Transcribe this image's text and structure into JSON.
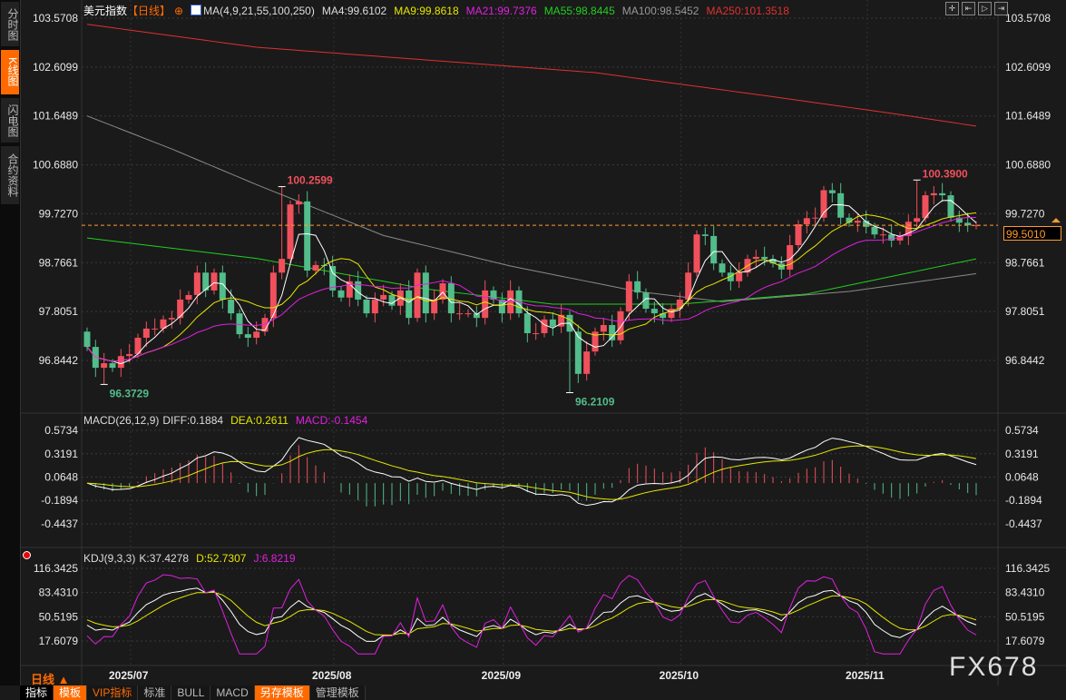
{
  "sidebar": {
    "tabs": [
      {
        "label": "分时图",
        "active": false
      },
      {
        "label": "K线图",
        "active": true
      },
      {
        "label": "闪电图",
        "active": false
      },
      {
        "label": "合约资料",
        "active": false
      }
    ]
  },
  "header": {
    "symbol": "美元指数",
    "period": "【日线】",
    "ma_label": "MA(4,9,21,55,100,250)",
    "ma4": "MA4:99.6102",
    "ma9": "MA9:99.8618",
    "ma21": "MA21:99.7376",
    "ma55": "MA55:98.8445",
    "ma100": "MA100:98.5452",
    "ma250": "MA250:101.3518"
  },
  "macd_header": {
    "label": "MACD(26,12,9)",
    "diff": "DIFF:0.1884",
    "dea": "DEA:0.2611",
    "macd": "MACD:-0.1454"
  },
  "kdj_header": {
    "label": "KDJ(9,3,3)",
    "k": "K:37.4278",
    "d": "D:52.7307",
    "j": "J:6.8219"
  },
  "tools": [
    "crosshair-icon",
    "zoom-start-icon",
    "play-icon",
    "jump-end-icon"
  ],
  "last_price": "99.5010",
  "period_selector": "日线 ▲",
  "watermark": "FX678",
  "toolbar": [
    {
      "label": "指标",
      "style": "white"
    },
    {
      "label": "模板",
      "style": "orange"
    },
    {
      "label": "VIP指标",
      "style": "vip"
    },
    {
      "label": "标准",
      "style": ""
    },
    {
      "label": "BULL",
      "style": ""
    },
    {
      "label": "MACD",
      "style": ""
    },
    {
      "label": "另存模板",
      "style": "orange"
    },
    {
      "label": "管理模板",
      "style": ""
    }
  ],
  "colors": {
    "up": "#f0505c",
    "down": "#52bc8a",
    "ma4": "#ffffff",
    "ma9": "#e6e600",
    "ma21": "#e020e0",
    "ma55": "#20d020",
    "ma100": "#8a8a8a",
    "ma250": "#e03030",
    "last": "#ff9a30"
  },
  "chart_data": [
    {
      "type": "candlestick",
      "title": "美元指数【日线】",
      "x_labels": [
        "2025/07",
        "2025/08",
        "2025/09",
        "2025/10",
        "2025/11"
      ],
      "x_label_index": [
        3,
        27,
        47,
        68,
        90
      ],
      "y_ticks": [
        "103.5708",
        "102.6099",
        "101.6489",
        "100.6880",
        "99.7270",
        "98.7661",
        "97.8051",
        "96.8442"
      ],
      "ylim": [
        96.0,
        103.7
      ],
      "annotations": [
        {
          "text": "100.2599",
          "index": 23,
          "value": 100.2599,
          "type": "high"
        },
        {
          "text": "96.3729",
          "index": 2,
          "value": 96.3729,
          "type": "low"
        },
        {
          "text": "100.3900",
          "index": 98,
          "value": 100.39,
          "type": "high"
        },
        {
          "text": "96.2109",
          "index": 57,
          "value": 96.2109,
          "type": "low"
        }
      ],
      "close": [
        97.11,
        96.7,
        96.79,
        96.7,
        96.93,
        96.97,
        97.29,
        97.47,
        97.47,
        97.65,
        97.68,
        98.04,
        98.13,
        98.57,
        98.22,
        98.57,
        98.04,
        97.77,
        97.36,
        97.29,
        97.41,
        97.68,
        98.57,
        98.84,
        99.91,
        99.97,
        98.61,
        98.72,
        98.7,
        98.22,
        98.08,
        98.4,
        98.04,
        97.77,
        98.04,
        98.13,
        97.92,
        98.22,
        97.68,
        98.57,
        97.77,
        98.04,
        98.36,
        97.77,
        97.77,
        97.77,
        97.68,
        98.22,
        98.04,
        97.77,
        98.22,
        97.77,
        97.38,
        97.38,
        97.65,
        97.51,
        97.74,
        97.41,
        96.58,
        97.02,
        97.41,
        97.54,
        97.24,
        97.81,
        98.4,
        98.18,
        97.86,
        97.77,
        97.68,
        97.86,
        98.04,
        98.57,
        99.32,
        99.29,
        98.75,
        98.57,
        98.4,
        98.57,
        98.84,
        98.88,
        98.84,
        98.75,
        98.63,
        99.11,
        99.52,
        99.64,
        99.65,
        100.19,
        100.13,
        99.65,
        99.55,
        99.59,
        99.47,
        99.32,
        99.32,
        99.2,
        99.29,
        99.57,
        99.64,
        100.09,
        100.13,
        100.09,
        99.65,
        99.55,
        99.5,
        99.501
      ],
      "ma55_points": [
        [
          0,
          99.25
        ],
        [
          20,
          98.85
        ],
        [
          40,
          98.25
        ],
        [
          55,
          97.95
        ],
        [
          70,
          97.95
        ],
        [
          85,
          98.15
        ],
        [
          105,
          98.84
        ]
      ],
      "ma100_points": [
        [
          0,
          101.65
        ],
        [
          10,
          101.0
        ],
        [
          20,
          100.3
        ],
        [
          35,
          99.3
        ],
        [
          50,
          98.7
        ],
        [
          65,
          98.2
        ],
        [
          75,
          98.0
        ],
        [
          90,
          98.2
        ],
        [
          105,
          98.55
        ]
      ],
      "ma250_points": [
        [
          0,
          103.45
        ],
        [
          20,
          103.0
        ],
        [
          40,
          102.75
        ],
        [
          60,
          102.5
        ],
        [
          80,
          102.05
        ],
        [
          95,
          101.7
        ],
        [
          105,
          101.45
        ]
      ]
    },
    {
      "type": "macd",
      "y_ticks": [
        "0.5734",
        "0.3191",
        "0.0648",
        "-0.1894",
        "-0.4437"
      ],
      "ylim": [
        -0.62,
        0.65
      ],
      "params": [
        26,
        12,
        9
      ]
    },
    {
      "type": "kdj",
      "y_ticks": [
        "116.3425",
        "83.4310",
        "50.5195",
        "17.6079"
      ],
      "ylim": [
        0,
        125
      ],
      "params": [
        9,
        3,
        3
      ]
    }
  ]
}
